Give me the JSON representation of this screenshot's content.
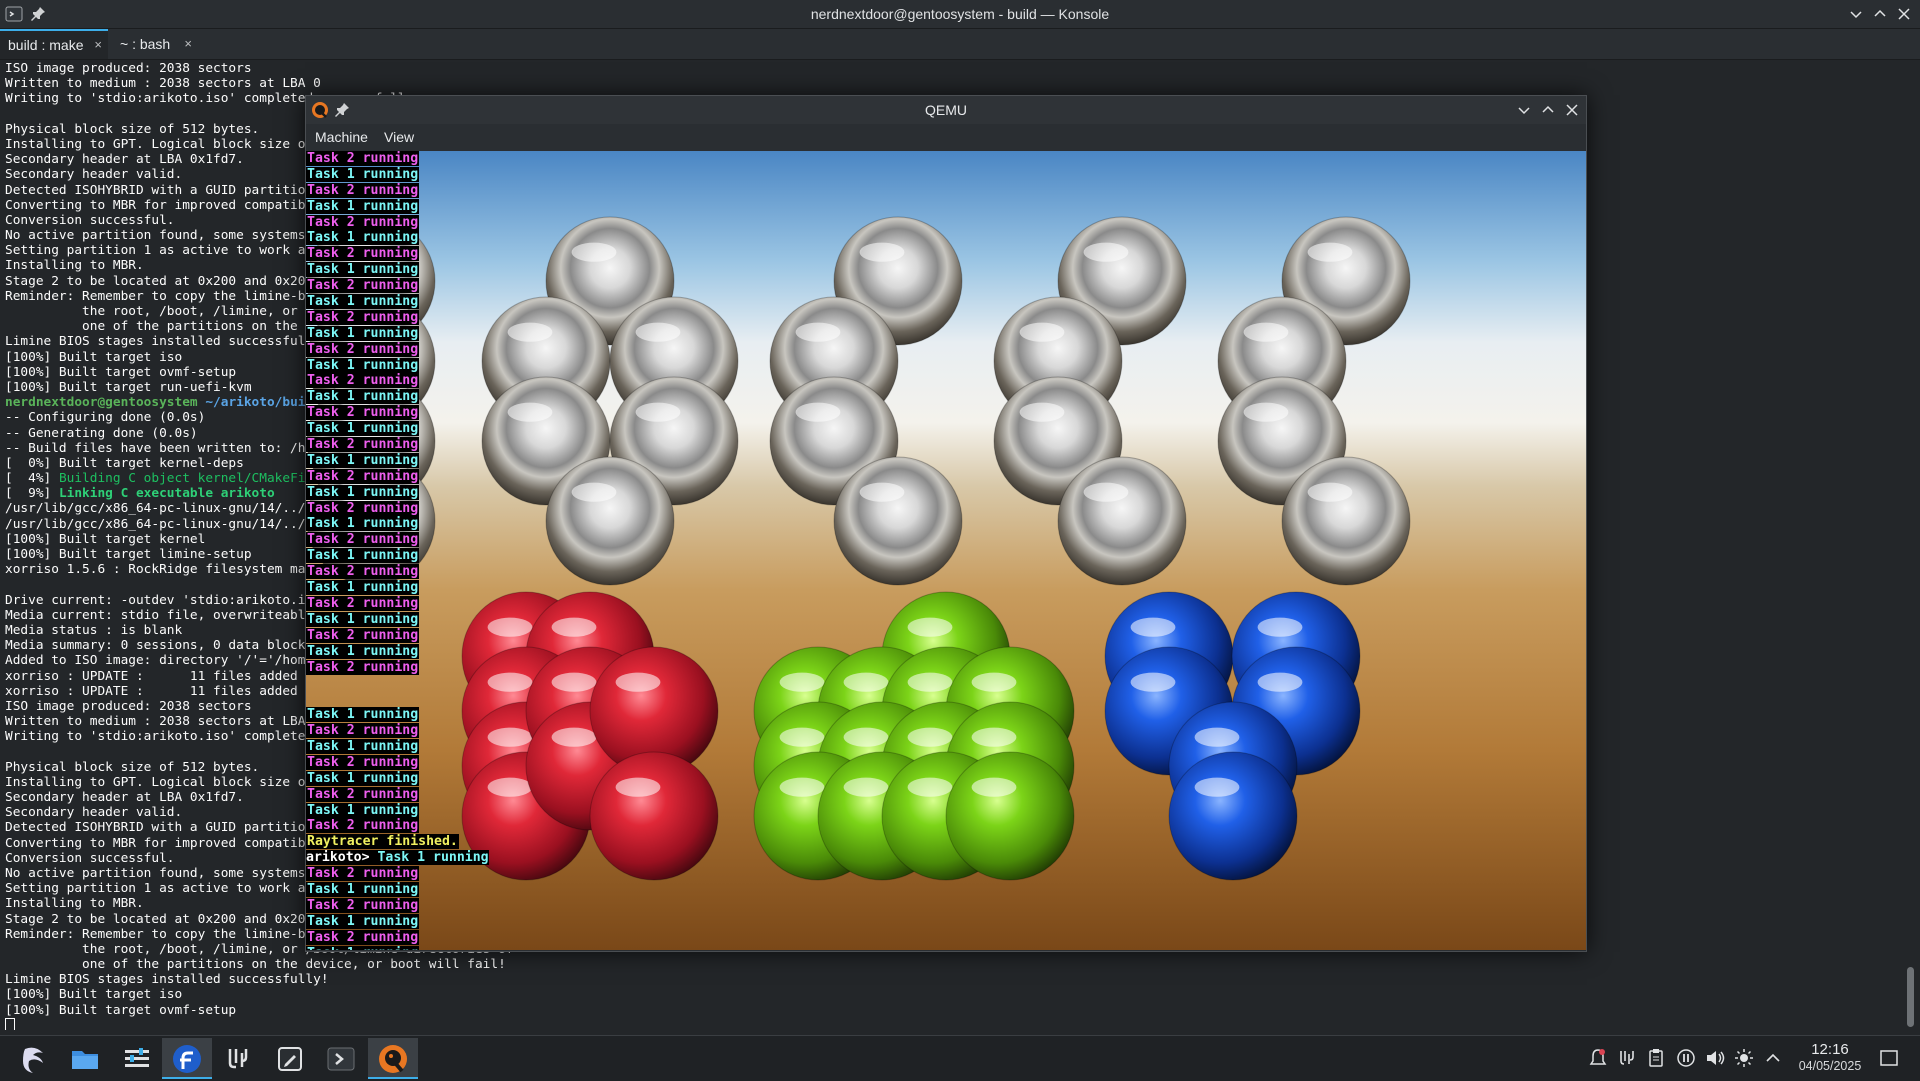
{
  "konsole": {
    "title": "nerdnextdoor@gentoosystem - build — Konsole",
    "tabs": [
      {
        "label": "build : make",
        "close": "×"
      },
      {
        "label": "~ : bash",
        "close": "×"
      }
    ],
    "lines": [
      {
        "t": "ISO image produced: 2038 sectors"
      },
      {
        "t": "Written to medium : 2038 sectors at LBA 0"
      },
      {
        "t": "Writing to 'stdio:arikoto.iso' completed successfully."
      },
      {
        "t": ""
      },
      {
        "t": "Physical block size of 512 bytes."
      },
      {
        "t": "Installing to GPT. Logical block size of 512 bytes."
      },
      {
        "t": "Secondary header at LBA 0x1fd7."
      },
      {
        "t": "Secondary header valid."
      },
      {
        "t": "Detected ISOHYBRID with a GUID partition table."
      },
      {
        "t": "Converting to MBR for improved compatibility..."
      },
      {
        "t": "Conversion successful."
      },
      {
        "t": "No active partition found, some systems may not boot."
      },
      {
        "t": "Setting partition 1 as active to work around the issue."
      },
      {
        "t": "Installing to MBR."
      },
      {
        "t": "Stage 2 to be located at 0x200 and 0x200."
      },
      {
        "t": "Reminder: Remember to copy the limine-bios.sys file in either"
      },
      {
        "t": "          the root, /boot, /limine, or /boot/limine directories of"
      },
      {
        "t": "          one of the partitions on the device, or boot will fail!"
      },
      {
        "t": "Limine BIOS stages installed successfully!"
      },
      {
        "t": "[100%] Built target iso"
      },
      {
        "t": "[100%] Built target ovmf-setup"
      },
      {
        "t": "[100%] Built target run-uefi-kvm"
      },
      {
        "prompt": "nerdnextdoor@gentoosystem",
        "path": " ~/arikoto/build"
      },
      {
        "t": "-- Configuring done (0.0s)"
      },
      {
        "t": "-- Generating done (0.0s)"
      },
      {
        "t": "-- Build files have been written to: /home/nerdnextdoor/arikoto/build"
      },
      {
        "t": "[  0%] Built target kernel-deps"
      },
      {
        "pre": "[  4%] ",
        "g": "Building C object kernel/CMakeFiles/arikoto.dir/main.c.o"
      },
      {
        "pre": "[  9%] ",
        "gb": "Linking C executable arikoto"
      },
      {
        "t": "/usr/lib/gcc/x86_64-pc-linux-gnu/14/../../../../x86_64-pc-linux-gnu/bin/ld"
      },
      {
        "t": "/usr/lib/gcc/x86_64-pc-linux-gnu/14/../../../../x86_64-pc-linux-gnu/bin/ld"
      },
      {
        "t": "[100%] Built target kernel"
      },
      {
        "t": "[100%] Built target limine-setup"
      },
      {
        "t": "xorriso 1.5.6 : RockRidge filesystem manipulator, libburnia project."
      },
      {
        "t": ""
      },
      {
        "t": "Drive current: -outdev 'stdio:arikoto.iso'"
      },
      {
        "t": "Media current: stdio file, overwriteable"
      },
      {
        "t": "Media status : is blank"
      },
      {
        "t": "Media summary: 0 sessions, 0 data blocks, 0 data, 1.2t free"
      },
      {
        "t": "Added to ISO image: directory '/'='/home/nerdnextdoor/arikoto/build/iso_root'"
      },
      {
        "t": "xorriso : UPDATE :      11 files added in 1 seconds"
      },
      {
        "t": "xorriso : UPDATE :      11 files added in 1 seconds"
      },
      {
        "t": "ISO image produced: 2038 sectors"
      },
      {
        "t": "Written to medium : 2038 sectors at LBA 0"
      },
      {
        "t": "Writing to 'stdio:arikoto.iso' completed successfully."
      },
      {
        "t": ""
      },
      {
        "t": "Physical block size of 512 bytes."
      },
      {
        "t": "Installing to GPT. Logical block size of 512 bytes."
      },
      {
        "t": "Secondary header at LBA 0x1fd7."
      },
      {
        "t": "Secondary header valid."
      },
      {
        "t": "Detected ISOHYBRID with a GUID partition table."
      },
      {
        "t": "Converting to MBR for improved compatibility..."
      },
      {
        "t": "Conversion successful."
      },
      {
        "t": "No active partition found, some systems may not boot."
      },
      {
        "t": "Setting partition 1 as active to work around the issue."
      },
      {
        "t": "Installing to MBR."
      },
      {
        "t": "Stage 2 to be located at 0x200 and 0x200."
      },
      {
        "t": "Reminder: Remember to copy the limine-bios.sys file in either"
      },
      {
        "t": "          the root, /boot, /limine, or /boot/limine directories of"
      },
      {
        "t": "          one of the partitions on the device, or boot will fail!"
      },
      {
        "t": "Limine BIOS stages installed successfully!"
      },
      {
        "t": "[100%] Built target iso"
      },
      {
        "t": "[100%] Built target ovmf-setup"
      }
    ]
  },
  "qemu": {
    "title": "QEMU",
    "menu": [
      "Machine",
      "View"
    ],
    "console_top": [
      "Task 2 running",
      "Task 1 running",
      "Task 2 running",
      "Task 1 running",
      "Task 2 running",
      "Task 1 running",
      "Task 2 running",
      "Task 1 running",
      "Task 2 running",
      "Task 1 running",
      "Task 2 running",
      "Task 1 running",
      "Task 2 running",
      "Task 1 running",
      "Task 2 running",
      "Task 1 running",
      "Task 2 running",
      "Task 1 running",
      "Task 2 running",
      "Task 1 running",
      "Task 2 running",
      "Task 1 running",
      "Task 2 running",
      "Task 1 running",
      "Task 2 running",
      "Task 1 running",
      "Task 2 running",
      "Task 1 running",
      "Task 2 running",
      "Task 1 running",
      "Task 2 running",
      "Task 1 running",
      "Task 2 running"
    ],
    "console_bottom": [
      "Task 1 running",
      "Task 2 running",
      "Task 1 running",
      "Task 2 running",
      "Task 1 running",
      "Task 2 running",
      "Task 1 running",
      "Task 2 running"
    ],
    "finished": "Raytracer finished.",
    "prompt": "arikoto>",
    "prompt_text": " Task 1 running",
    "console_after": [
      "Task 2 running",
      "Task 1 running",
      "Task 2 running",
      "Task 1 running",
      "Task 2 running",
      "Task 1 running"
    ]
  },
  "taskbar": {
    "apps": [
      "app-launcher-icon",
      "file-manager-icon",
      "system-settings-icon",
      "fedora-media-writer-icon",
      "kde-connect-icon",
      "text-editor-icon",
      "konsole-icon",
      "qemu-icon"
    ],
    "tray": [
      "notifications-icon",
      "kde-connect-tray-icon",
      "clipboard-icon",
      "media-pause-icon",
      "volume-icon",
      "brightness-icon",
      "show-hidden-icons-icon"
    ],
    "time": "12:16",
    "date": "04/05/2025"
  },
  "colors": {
    "accent": "#3daee9",
    "red_balls": "#d42030",
    "green_balls": "#6ec414",
    "blue_balls": "#1a4fd8"
  }
}
